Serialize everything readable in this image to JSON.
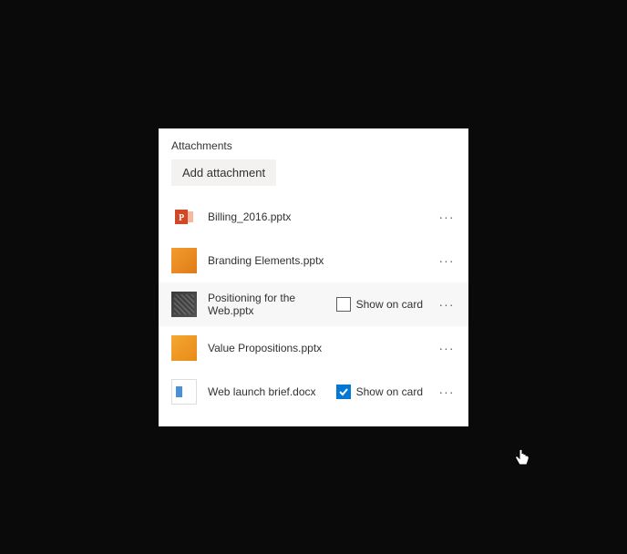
{
  "section_title": "Attachments",
  "add_button_label": "Add attachment",
  "show_on_card_label": "Show on card",
  "more_glyph": "···",
  "files": [
    {
      "name": "Billing_2016.pptx",
      "thumb": "ppt-icon",
      "hovered": false,
      "show_checkbox_visible": false,
      "show_checked": false
    },
    {
      "name": "Branding Elements.pptx",
      "thumb": "orange",
      "hovered": false,
      "show_checkbox_visible": false,
      "show_checked": false
    },
    {
      "name": "Positioning for the Web.pptx",
      "thumb": "dark",
      "hovered": true,
      "show_checkbox_visible": true,
      "show_checked": false
    },
    {
      "name": "Value Propositions.pptx",
      "thumb": "orange2",
      "hovered": false,
      "show_checkbox_visible": false,
      "show_checked": false
    },
    {
      "name": "Web launch brief.docx",
      "thumb": "doc",
      "hovered": false,
      "show_checkbox_visible": true,
      "show_checked": true
    }
  ]
}
